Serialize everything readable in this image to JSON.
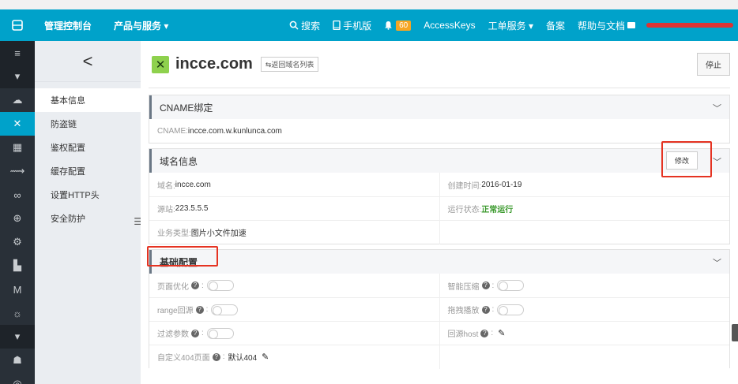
{
  "topbar": {
    "brand": "管理控制台",
    "products": "产品与服务 ▾",
    "search": "搜索",
    "mobile": "手机版",
    "notifications": "60",
    "accesskeys": "AccessKeys",
    "workorder": "工单服务 ▾",
    "beian": "备案",
    "help": "帮助与文档",
    "colors": {
      "bg": "#00a2ca",
      "badge": "#f5a623"
    }
  },
  "sidebar": {
    "back": "<",
    "items": [
      {
        "label": "基本信息"
      },
      {
        "label": "防盗链"
      },
      {
        "label": "鉴权配置"
      },
      {
        "label": "缓存配置"
      },
      {
        "label": "设置HTTP头"
      },
      {
        "label": "安全防护"
      }
    ]
  },
  "header": {
    "domain": "incce.com",
    "back_to_list": "⇆返回域名列表",
    "stop": "停止"
  },
  "cname": {
    "title": "CNAME绑定",
    "label": "CNAME: ",
    "value": "incce.com.w.kunlunca.com"
  },
  "domain_info": {
    "title": "域名信息",
    "edit": "修改",
    "domain_label": "域名: ",
    "domain_value": "incce.com",
    "created_label": "创建时间: ",
    "created_value": "2016-01-19",
    "origin_label": "源站: ",
    "origin_value": "223.5.5.5",
    "status_label": "运行状态: ",
    "status_value": "正常运行",
    "biz_label": "业务类型: ",
    "biz_value": "图片小文件加速"
  },
  "basic_config": {
    "title": "基础配置",
    "page_opt": "页面优化",
    "smart_compress": "智能压缩",
    "range": "range回源",
    "drag_play": "拖拽播放",
    "filter_params": "过滤参数",
    "origin_host": "回源host",
    "custom404": "自定义404页面",
    "custom404_value": "默认404"
  }
}
